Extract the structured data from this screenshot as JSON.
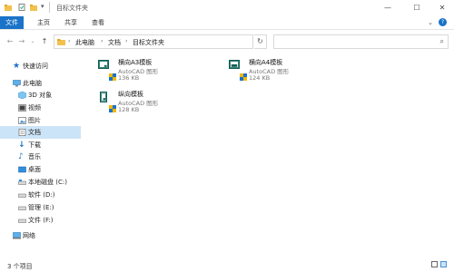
{
  "window": {
    "title": "目标文件夹",
    "controls": {
      "minimize": "—",
      "maximize": "☐",
      "close": "✕"
    }
  },
  "ribbon": {
    "tabs": [
      "文件",
      "主页",
      "共享",
      "查看"
    ],
    "expand": "⌄",
    "help": "?"
  },
  "address": {
    "breadcrumbs": [
      "此电脑",
      "文档",
      "目标文件夹"
    ],
    "search_placeholder": ""
  },
  "sidebar": {
    "items": [
      {
        "label": "快速访问",
        "icon": "star-icon"
      },
      {
        "label": "此电脑",
        "icon": "computer-icon"
      },
      {
        "label": "3D 对象",
        "icon": "cube-icon"
      },
      {
        "label": "视频",
        "icon": "video-icon"
      },
      {
        "label": "图片",
        "icon": "picture-icon"
      },
      {
        "label": "文档",
        "icon": "document-icon",
        "selected": true
      },
      {
        "label": "下载",
        "icon": "download-icon"
      },
      {
        "label": "音乐",
        "icon": "music-icon"
      },
      {
        "label": "桌面",
        "icon": "desktop-icon"
      },
      {
        "label": "本地磁盘 (C:)",
        "icon": "drive-icon"
      },
      {
        "label": "软件 (D:)",
        "icon": "drive-icon"
      },
      {
        "label": "管理 (E:)",
        "icon": "drive-icon"
      },
      {
        "label": "文件 (F:)",
        "icon": "drive-icon"
      },
      {
        "label": "网络",
        "icon": "network-icon"
      }
    ]
  },
  "files": [
    {
      "name": "横向A3模板",
      "type": "AutoCAD 图形",
      "size": "136 KB"
    },
    {
      "name": "横向A4模板",
      "type": "AutoCAD 图形",
      "size": "124 KB"
    },
    {
      "name": "纵向模板",
      "type": "AutoCAD 图形",
      "size": "128 KB"
    }
  ],
  "status": {
    "item_count": "3 个项目"
  },
  "colors": {
    "accent": "#1a73c9",
    "selected": "#cce4f7",
    "dwg_frame": "#0b5f54"
  }
}
